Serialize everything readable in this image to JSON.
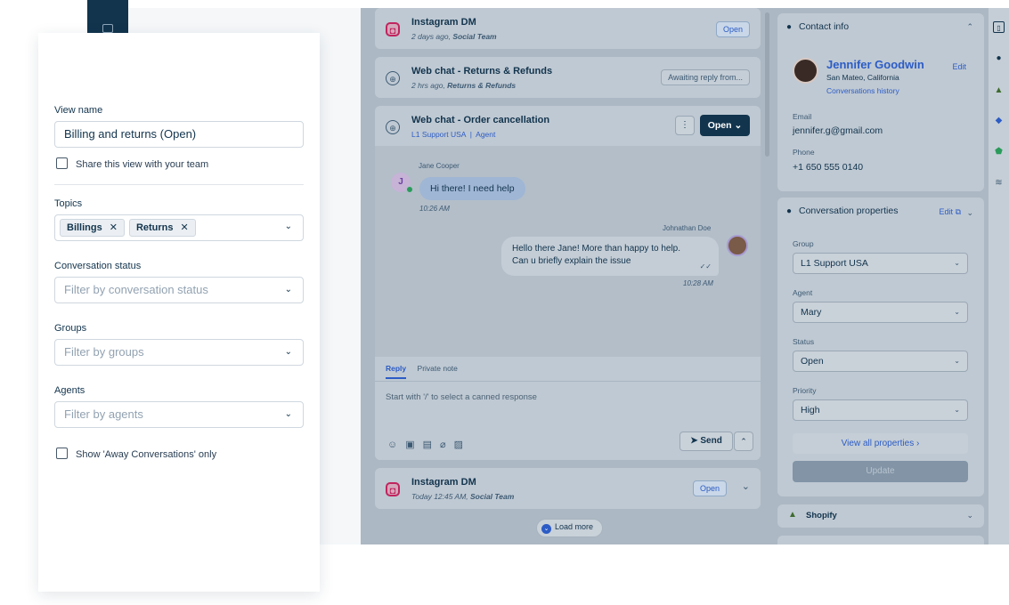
{
  "conversations": {
    "items": [
      {
        "title": "Instagram DM",
        "sub_time": "2 days ago, ",
        "sub_team": "Social Team",
        "status": "Open"
      },
      {
        "title": "Web chat - Returns & Refunds",
        "sub_time": "2 hrs ago, ",
        "sub_team": "Returns & Refunds",
        "status": "Awaiting reply from..."
      },
      {
        "title": "Web chat - Order cancellation",
        "group": "L1 Support USA",
        "role": "Agent",
        "status": "Open"
      },
      {
        "title": "Instagram DM",
        "sub_time": "Today 12:45 AM, ",
        "sub_team": "Social Team",
        "status": "Open"
      }
    ],
    "load_more": "Load more"
  },
  "chat": {
    "customer_name": "Jane Cooper",
    "customer_initial": "J",
    "customer_message": "Hi there! I need help",
    "customer_time": "10:26 AM",
    "agent_name": "Johnathan Doe",
    "agent_message_line1": "Hello there Jane! More than happy to help.",
    "agent_message_line2": "Can u briefly explain the issue",
    "agent_time": "10:28 AM"
  },
  "reply": {
    "tab_reply": "Reply",
    "tab_private": "Private note",
    "placeholder": "Start with '/' to select a canned response",
    "send_label": "Send"
  },
  "contact": {
    "header": "Contact info",
    "name": "Jennifer Goodwin",
    "location": "San Mateo, California",
    "history_link": "Conversations history",
    "edit": "Edit",
    "email_label": "Email",
    "email": "jennifer.g@gmail.com",
    "phone_label": "Phone",
    "phone": "+1 650 555 0140"
  },
  "properties": {
    "header": "Conversation properties",
    "edit": "Edit",
    "group_label": "Group",
    "group": "L1 Support USA",
    "agent_label": "Agent",
    "agent": "Mary",
    "status_label": "Status",
    "status": "Open",
    "priority_label": "Priority",
    "priority": "High",
    "view_all": "View all properties",
    "update": "Update"
  },
  "shopify": {
    "label": "Shopify"
  },
  "panel": {
    "view_name_label": "View name",
    "view_name_value": "Billing and returns (Open)",
    "share_label": "Share this view with your team",
    "topics_label": "Topics",
    "topics": [
      "Billings",
      "Returns"
    ],
    "status_label": "Conversation status",
    "status_placeholder": "Filter by conversation status",
    "groups_label": "Groups",
    "groups_placeholder": "Filter by groups",
    "agents_label": "Agents",
    "agents_placeholder": "Filter by agents",
    "away_label": "Show 'Away Conversations' only"
  },
  "colors": {
    "brand_navy": "#12344d",
    "link_blue": "#2c5cc5",
    "online_green": "#2a9b5b"
  }
}
